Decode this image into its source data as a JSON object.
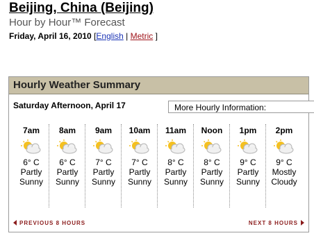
{
  "header": {
    "title": "Beijing, China (Beijing)",
    "subtitle": "Hour by Hour™ Forecast",
    "date": "Friday, April 16, 2010",
    "open_bracket": "[",
    "english_link": "English",
    "divider": "|",
    "metric_link": "Metric",
    "close_bracket": "]"
  },
  "summary": {
    "heading": "Hourly Weather Summary",
    "day_label": "Saturday Afternoon, April 17",
    "more_info": "More Hourly Information:",
    "prev_link": "PREVIOUS 8 HOURS",
    "next_link": "NEXT 8 HOURS",
    "hours": [
      {
        "time": "7am",
        "temp": "6° C",
        "cond1": "Partly",
        "cond2": "Sunny",
        "icon": "partly-sunny-icon"
      },
      {
        "time": "8am",
        "temp": "6° C",
        "cond1": "Partly",
        "cond2": "Sunny",
        "icon": "partly-sunny-icon"
      },
      {
        "time": "9am",
        "temp": "7° C",
        "cond1": "Partly",
        "cond2": "Sunny",
        "icon": "partly-sunny-icon"
      },
      {
        "time": "10am",
        "temp": "7° C",
        "cond1": "Partly",
        "cond2": "Sunny",
        "icon": "partly-sunny-icon"
      },
      {
        "time": "11am",
        "temp": "8° C",
        "cond1": "Partly",
        "cond2": "Sunny",
        "icon": "partly-sunny-icon"
      },
      {
        "time": "Noon",
        "temp": "8° C",
        "cond1": "Partly",
        "cond2": "Sunny",
        "icon": "partly-sunny-icon"
      },
      {
        "time": "1pm",
        "temp": "9° C",
        "cond1": "Partly",
        "cond2": "Sunny",
        "icon": "partly-sunny-icon"
      },
      {
        "time": "2pm",
        "temp": "9° C",
        "cond1": "Mostly",
        "cond2": "Cloudy",
        "icon": "mostly-cloudy-icon"
      }
    ]
  }
}
